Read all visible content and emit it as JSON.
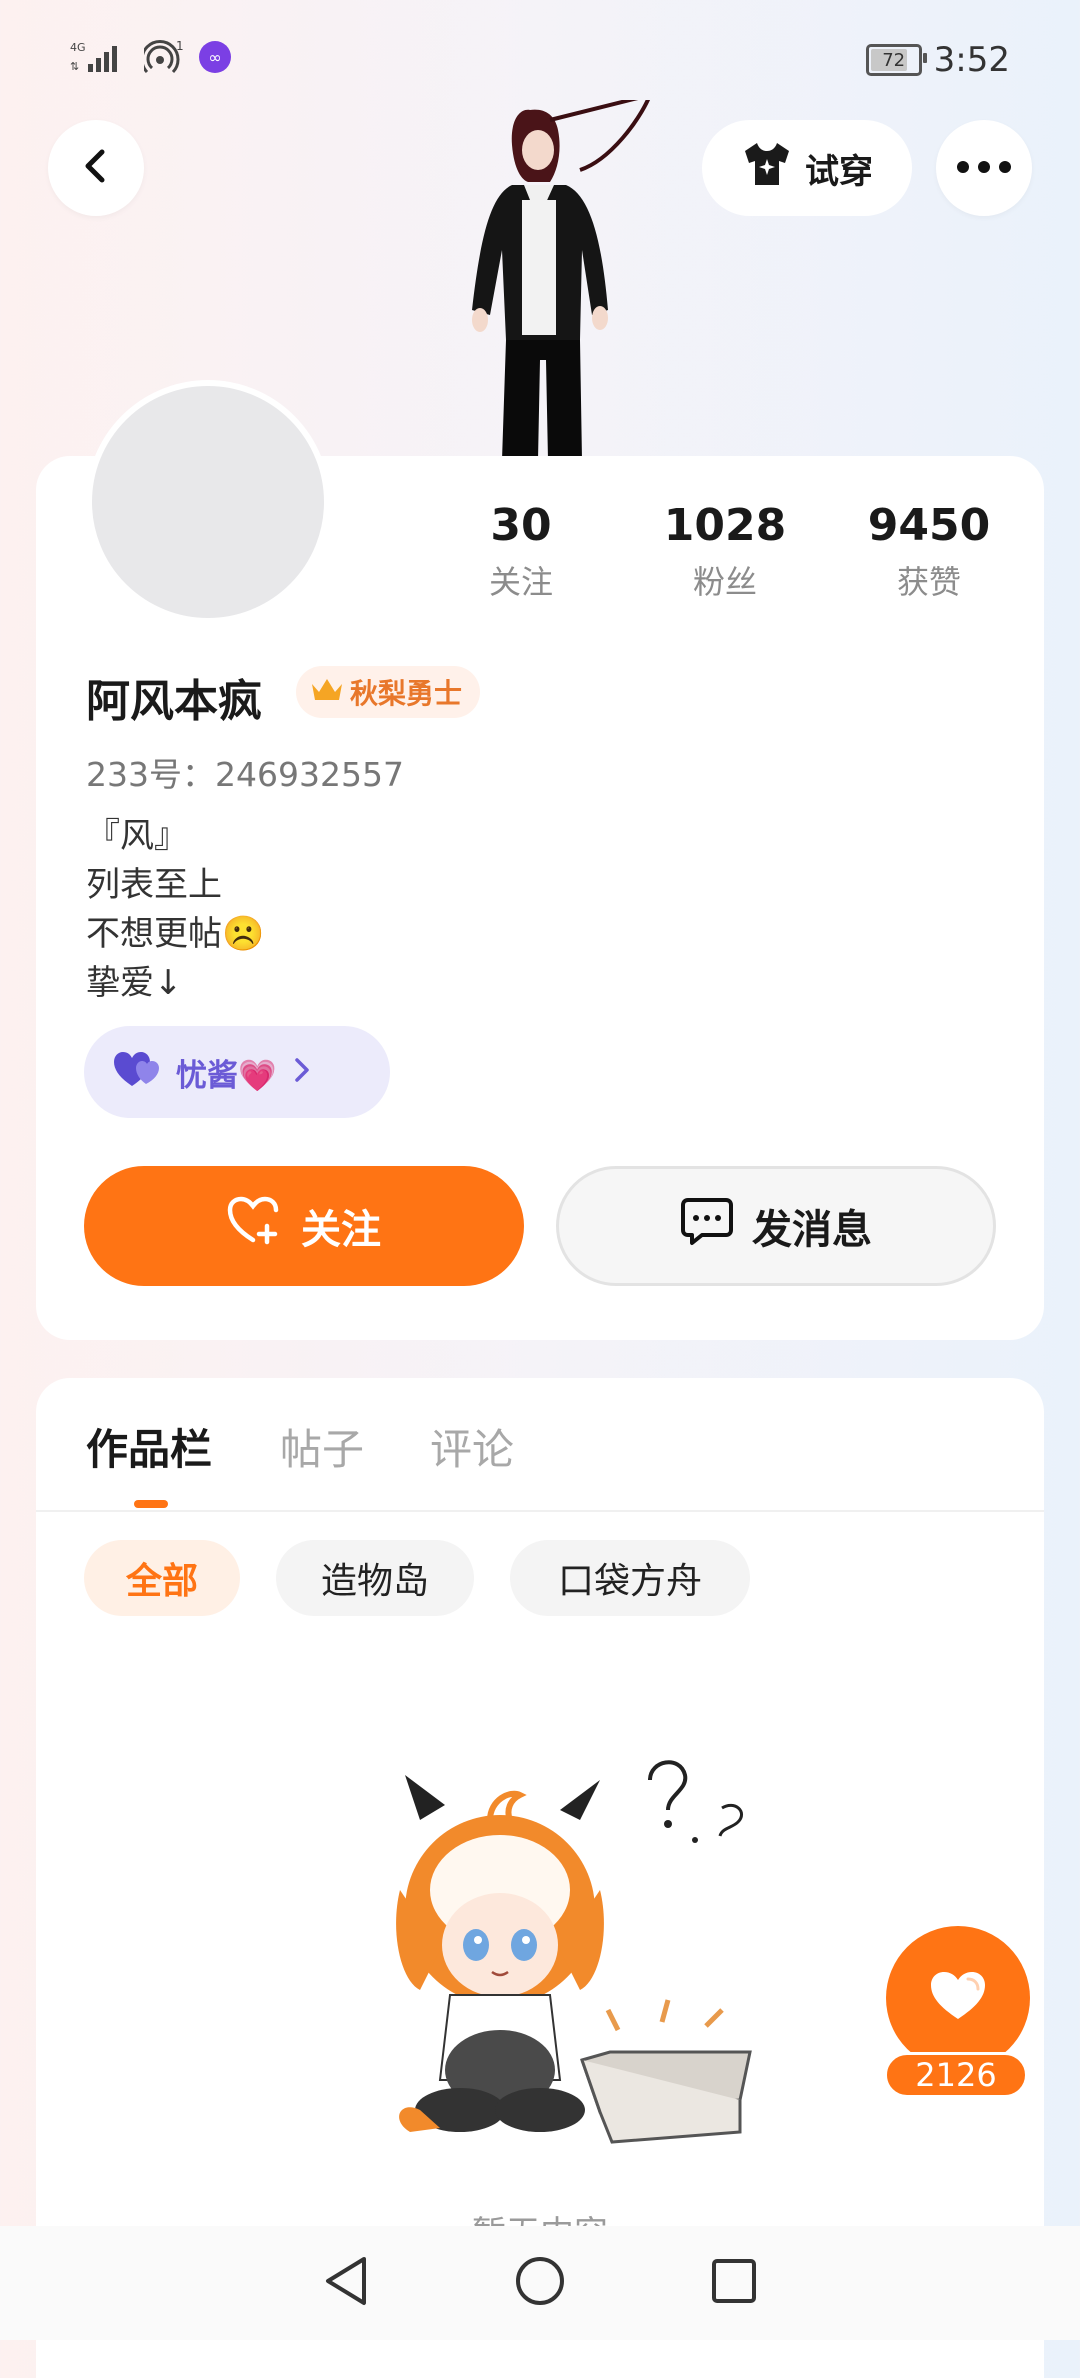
{
  "status_bar": {
    "network": "4G",
    "hotspot_count": "1",
    "battery": "72",
    "time": "3:52"
  },
  "top_actions": {
    "tryon_label": "试穿"
  },
  "profile": {
    "stats": [
      {
        "value": "30",
        "label": "关注"
      },
      {
        "value": "1028",
        "label": "粉丝"
      },
      {
        "value": "9450",
        "label": "获赞"
      }
    ],
    "username": "阿风本疯",
    "title_badge": "秋梨勇士",
    "uid": "233号：246932557",
    "bio": [
      "『风』",
      "列表至上",
      "不想更帖☹️",
      "挚爱↓"
    ],
    "club": "忧酱💗",
    "follow_label": "关注",
    "message_label": "发消息"
  },
  "works": {
    "tabs": [
      "作品栏",
      "帖子",
      "评论"
    ],
    "active_tab": "作品栏",
    "filters": [
      "全部",
      "造物岛",
      "口袋方舟"
    ],
    "active_filter": "全部",
    "empty_text": "暂无内容"
  },
  "like_fab": {
    "count": "2126"
  },
  "colors": {
    "accent": "#ff7414",
    "club_purple": "#6b5bd6",
    "badge_orange": "#e8772b"
  }
}
